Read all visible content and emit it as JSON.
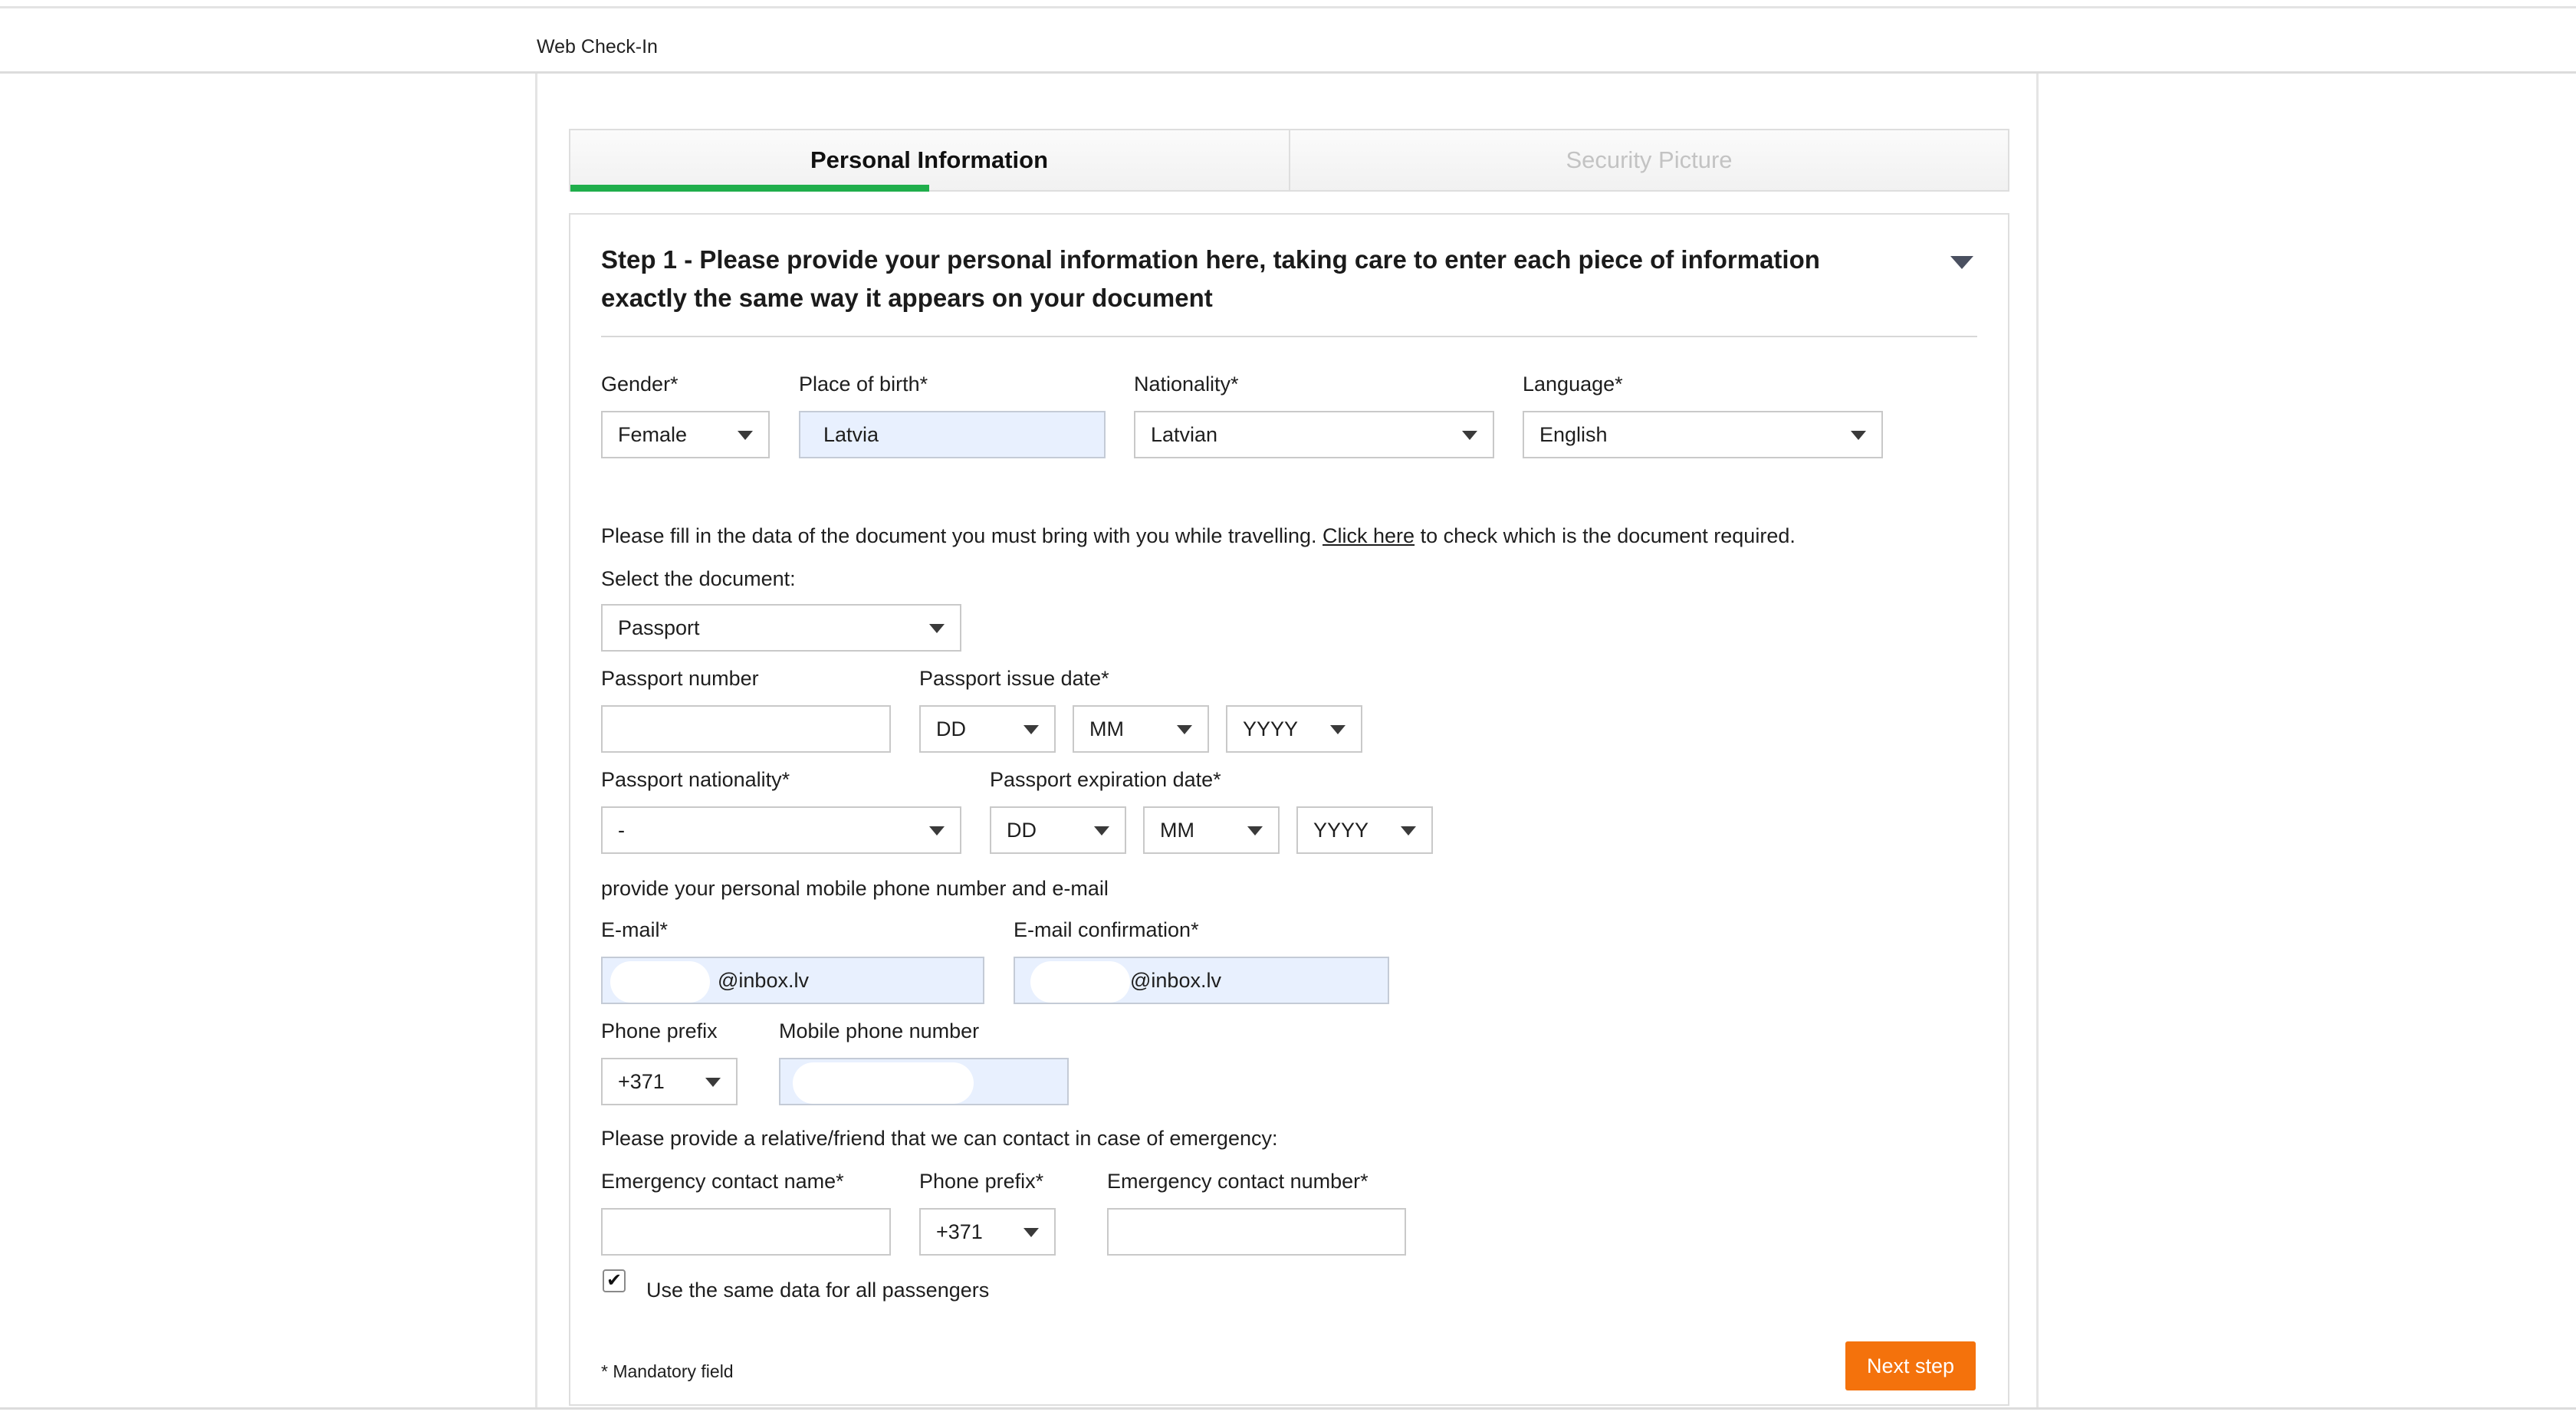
{
  "header": {
    "title": "Web Check-In"
  },
  "tabs": [
    {
      "label": "Personal Information",
      "active": true
    },
    {
      "label": "Security Picture",
      "active": false
    }
  ],
  "step": {
    "title": "Step 1 - Please provide your personal information here, taking care to enter each piece of information exactly the same way it appears on your document"
  },
  "personal": {
    "gender": {
      "label": "Gender*",
      "value": "Female"
    },
    "place_of_birth": {
      "label": "Place of birth*",
      "value": "Latvia"
    },
    "nationality": {
      "label": "Nationality*",
      "value": "Latvian"
    },
    "language": {
      "label": "Language*",
      "value": "English"
    }
  },
  "document": {
    "info_prefix": "Please fill in the data of the document you must bring with you while travelling.",
    "info_link": "Click here",
    "info_suffix": "to check which is the document required.",
    "select_label": "Select the document:",
    "select_value": "Passport",
    "passport_number": {
      "label": "Passport number",
      "value": ""
    },
    "issue_date": {
      "label": "Passport issue date*",
      "dd": "DD",
      "mm": "MM",
      "yyyy": "YYYY"
    },
    "passport_nationality": {
      "label": "Passport nationality*",
      "value": "-"
    },
    "expiration_date": {
      "label": "Passport expiration date*",
      "dd": "DD",
      "mm": "MM",
      "yyyy": "YYYY"
    }
  },
  "contact": {
    "intro": "provide your personal mobile phone number and e-mail",
    "email": {
      "label": "E-mail*",
      "value": "@inbox.lv"
    },
    "email_confirm": {
      "label": "E-mail confirmation*",
      "value": "@inbox.lv"
    },
    "phone_prefix": {
      "label": "Phone prefix",
      "value": "+371"
    },
    "mobile": {
      "label": "Mobile phone number",
      "value": ""
    }
  },
  "emergency": {
    "intro": "Please provide a relative/friend that we can contact in case of emergency:",
    "name": {
      "label": "Emergency contact name*",
      "value": ""
    },
    "prefix": {
      "label": "Phone prefix*",
      "value": "+371"
    },
    "number": {
      "label": "Emergency contact number*",
      "value": ""
    }
  },
  "same_data": {
    "label": "Use the same data for all passengers",
    "checked": true,
    "mark": "✔"
  },
  "footer": {
    "mandatory_note": "* Mandatory field",
    "next_button": "Next step"
  },
  "colors": {
    "accent_green": "#1fae4b",
    "button_orange": "#f4720c",
    "autofill_blue": "#e8f0fe"
  }
}
